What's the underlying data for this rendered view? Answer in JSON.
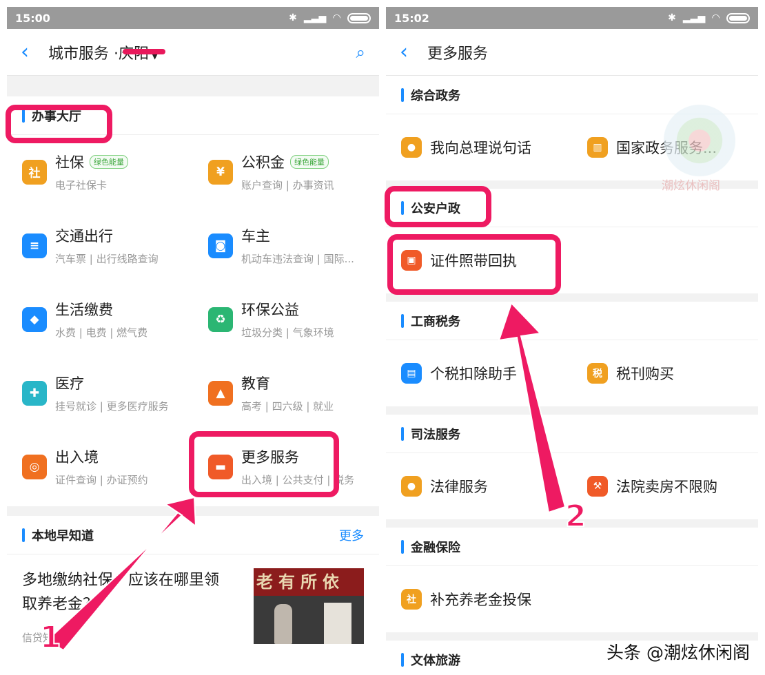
{
  "left": {
    "status": {
      "time": "15:00"
    },
    "nav": {
      "title": "城市服务 ·",
      "city": "庆阳"
    },
    "section_hall": "办事大厅",
    "services": [
      {
        "title": "社保",
        "badge": "绿色能量",
        "sub": "电子社保卡",
        "icon": "social-security-shield-icon",
        "glyph": "社",
        "color": "#f0a020"
      },
      {
        "title": "公积金",
        "badge": "绿色能量",
        "sub": "账户查询 | 办事资讯",
        "icon": "housing-fund-house-icon",
        "glyph": "¥",
        "color": "#f0a020"
      },
      {
        "title": "交通出行",
        "sub": "汽车票 | 出行线路查询",
        "icon": "traffic-light-icon",
        "glyph": "≡",
        "color": "#1a8cff"
      },
      {
        "title": "车主",
        "sub": "机动车违法查询 | 国际...",
        "icon": "car-icon",
        "glyph": "◙",
        "color": "#1a8cff"
      },
      {
        "title": "生活缴费",
        "sub": "水费 | 电费 | 燃气费",
        "icon": "water-drop-icon",
        "glyph": "◆",
        "color": "#1a8cff"
      },
      {
        "title": "环保公益",
        "sub": "垃圾分类 | 气象环境",
        "icon": "recycle-icon",
        "glyph": "♻",
        "color": "#2bb673"
      },
      {
        "title": "医疗",
        "sub": "挂号就诊 | 更多医疗服务",
        "icon": "medical-heart-icon",
        "glyph": "✚",
        "color": "#29b6c8"
      },
      {
        "title": "教育",
        "sub": "高考 | 四六级 | 就业",
        "icon": "graduation-cap-icon",
        "glyph": "▲",
        "color": "#f07020"
      },
      {
        "title": "出入境",
        "sub": "证件查询 | 办证预约",
        "icon": "globe-plane-icon",
        "glyph": "◎",
        "color": "#f07020"
      },
      {
        "title": "更多服务",
        "sub": "出入境 | 公共支付 | 税务",
        "icon": "more-services-box-icon",
        "glyph": "▬",
        "color": "#f05a28"
      }
    ],
    "section_local": "本地早知道",
    "more": "更多",
    "news": {
      "title": "多地缴纳社保，应该在哪里领取养老金？",
      "source": "信贷知识",
      "sign": "老有所依"
    }
  },
  "right": {
    "status": {
      "time": "15:02"
    },
    "nav": {
      "title": "更多服务"
    },
    "sections": [
      {
        "name": "综合政务",
        "items": [
          {
            "label": "我向总理说句话",
            "icon": "premier-person-icon",
            "glyph": "●",
            "color": "#f0a020"
          },
          {
            "label": "国家政务服务...",
            "icon": "government-building-icon",
            "glyph": "▥",
            "color": "#f0a020"
          }
        ]
      },
      {
        "name": "公安户政",
        "items": [
          {
            "label": "证件照带回执",
            "icon": "id-photo-icon",
            "glyph": "▣",
            "color": "#f05a28"
          }
        ]
      },
      {
        "name": "工商税务",
        "items": [
          {
            "label": "个税扣除助手",
            "icon": "tax-document-icon",
            "glyph": "▤",
            "color": "#1a8cff"
          },
          {
            "label": "税刊购买",
            "icon": "tax-journal-icon",
            "glyph": "税",
            "color": "#f0a020"
          }
        ]
      },
      {
        "name": "司法服务",
        "items": [
          {
            "label": "法律服务",
            "icon": "lawyer-icon",
            "glyph": "●",
            "color": "#f0a020"
          },
          {
            "label": "法院卖房不限购",
            "icon": "court-gavel-icon",
            "glyph": "⚒",
            "color": "#f05a28"
          }
        ]
      },
      {
        "name": "金融保险",
        "items": [
          {
            "label": "补充养老金投保",
            "icon": "pension-shield-icon",
            "glyph": "社",
            "color": "#f0a020"
          }
        ]
      },
      {
        "name": "文体旅游",
        "items": []
      }
    ],
    "watermark": "头条 @潮炫休闲阁",
    "logo_text": "潮炫休闲阁"
  },
  "annotations": {
    "step1": "1",
    "step2": "2"
  }
}
